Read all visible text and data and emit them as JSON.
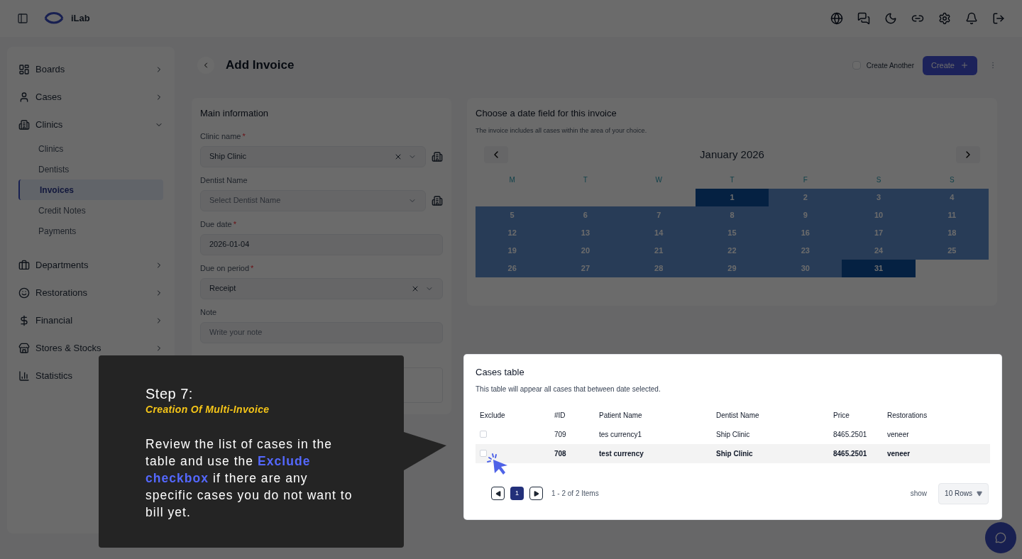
{
  "app": {
    "logo_text": "iLab"
  },
  "sidebar": {
    "items": [
      {
        "label": "Boards",
        "expanded": false
      },
      {
        "label": "Cases",
        "expanded": false
      },
      {
        "label": "Clinics",
        "expanded": true,
        "children": [
          {
            "label": "Clinics",
            "selected": false
          },
          {
            "label": "Dentists",
            "selected": false
          },
          {
            "label": "Invoices",
            "selected": true
          },
          {
            "label": "Credit Notes",
            "selected": false
          },
          {
            "label": "Payments",
            "selected": false
          }
        ]
      },
      {
        "label": "Departments",
        "expanded": false
      },
      {
        "label": "Restorations",
        "expanded": false
      },
      {
        "label": "Financial",
        "expanded": false
      },
      {
        "label": "Stores & Stocks",
        "expanded": false
      },
      {
        "label": "Statistics",
        "expanded": false
      }
    ]
  },
  "page": {
    "title": "Add Invoice",
    "create_another": {
      "label": "Create Another",
      "checked": false
    },
    "create_button": "Create"
  },
  "main_info": {
    "title": "Main information",
    "required_mark": "*",
    "fields": [
      {
        "label": "Clinic name",
        "required": true,
        "value": "Ship Clinic",
        "kind": "select",
        "clearable": true,
        "add": true
      },
      {
        "label": "Dentist Name",
        "required": false,
        "placeholder": "Select Dentist Name",
        "kind": "select",
        "clearable": false,
        "add": true
      },
      {
        "label": "Due date",
        "required": true,
        "value": "2026-01-04",
        "kind": "input",
        "clearable": false,
        "add": false
      },
      {
        "label": "Due on period",
        "required": true,
        "value": "Receipt",
        "kind": "select",
        "clearable": true,
        "add": false
      },
      {
        "label": "Note",
        "required": false,
        "placeholder": "Write your note",
        "kind": "input",
        "clearable": false,
        "add": false
      }
    ]
  },
  "calendar": {
    "title": "Choose a date field for this invoice",
    "subtitle": "The invoice includes all cases within the area of your choice.",
    "month": "January 2026",
    "weekdays": [
      "M",
      "T",
      "W",
      "T",
      "F",
      "S",
      "S"
    ],
    "weeks": [
      [
        {
          "kind": "blank"
        },
        {
          "kind": "blank"
        },
        {
          "kind": "blank"
        },
        {
          "kind": "day",
          "day": "1",
          "selected": true,
          "in_range": true
        },
        {
          "kind": "day",
          "day": "2",
          "selected": false,
          "in_range": true
        },
        {
          "kind": "day",
          "day": "3",
          "selected": false,
          "in_range": true
        },
        {
          "kind": "day",
          "day": "4",
          "selected": false,
          "in_range": true
        }
      ],
      [
        {
          "kind": "day",
          "day": "5",
          "selected": false,
          "in_range": true
        },
        {
          "kind": "day",
          "day": "6",
          "selected": false,
          "in_range": true
        },
        {
          "kind": "day",
          "day": "7",
          "selected": false,
          "in_range": true
        },
        {
          "kind": "day",
          "day": "8",
          "selected": false,
          "in_range": true
        },
        {
          "kind": "day",
          "day": "9",
          "selected": false,
          "in_range": true
        },
        {
          "kind": "day",
          "day": "10",
          "selected": false,
          "in_range": true
        },
        {
          "kind": "day",
          "day": "11",
          "selected": false,
          "in_range": true
        }
      ],
      [
        {
          "kind": "day",
          "day": "12",
          "selected": false,
          "in_range": true
        },
        {
          "kind": "day",
          "day": "13",
          "selected": false,
          "in_range": true
        },
        {
          "kind": "day",
          "day": "14",
          "selected": false,
          "in_range": true
        },
        {
          "kind": "day",
          "day": "15",
          "selected": false,
          "in_range": true
        },
        {
          "kind": "day",
          "day": "16",
          "selected": false,
          "in_range": true
        },
        {
          "kind": "day",
          "day": "17",
          "selected": false,
          "in_range": true
        },
        {
          "kind": "day",
          "day": "18",
          "selected": false,
          "in_range": true
        }
      ],
      [
        {
          "kind": "day",
          "day": "19",
          "selected": false,
          "in_range": true
        },
        {
          "kind": "day",
          "day": "20",
          "selected": false,
          "in_range": true
        },
        {
          "kind": "day",
          "day": "21",
          "selected": false,
          "in_range": true
        },
        {
          "kind": "day",
          "day": "22",
          "selected": false,
          "in_range": true
        },
        {
          "kind": "day",
          "day": "23",
          "selected": false,
          "in_range": true
        },
        {
          "kind": "day",
          "day": "24",
          "selected": false,
          "in_range": true
        },
        {
          "kind": "day",
          "day": "25",
          "selected": false,
          "in_range": true
        }
      ],
      [
        {
          "kind": "day",
          "day": "26",
          "selected": false,
          "in_range": true
        },
        {
          "kind": "day",
          "day": "27",
          "selected": false,
          "in_range": true
        },
        {
          "kind": "day",
          "day": "28",
          "selected": false,
          "in_range": true
        },
        {
          "kind": "day",
          "day": "29",
          "selected": false,
          "in_range": true
        },
        {
          "kind": "day",
          "day": "30",
          "selected": false,
          "in_range": true
        },
        {
          "kind": "day",
          "day": "31",
          "selected": true,
          "in_range": true
        },
        {
          "kind": "blank"
        }
      ]
    ]
  },
  "cases_table": {
    "title": "Cases table",
    "subtitle": "This table will appear all cases that between date selected.",
    "exclude_column": "Exclude",
    "columns": [
      "#ID",
      "Patient Name",
      "Dentist Name",
      "Price",
      "Restorations"
    ],
    "rows": [
      {
        "exclude": false,
        "hovered": false,
        "cells": [
          "709",
          "tes currency1",
          "Ship Clinic",
          "8465.2501",
          "veneer"
        ]
      },
      {
        "exclude": false,
        "hovered": true,
        "cells": [
          "708",
          "test currency",
          "Ship Clinic",
          "8465.2501",
          "veneer"
        ]
      }
    ],
    "pages": [
      {
        "label": "1",
        "selected": true
      }
    ],
    "range_text": "1 - 2 of 2 Items",
    "show_label": "show",
    "rows_select": "10 Rows"
  },
  "tour": {
    "step": "Step 7:",
    "subtitle": "Creation Of Multi-Invoice",
    "body": "Review the list of cases in the table and use the **Exclude checkbox** if there are any specific cases you do not want to bill yet."
  }
}
